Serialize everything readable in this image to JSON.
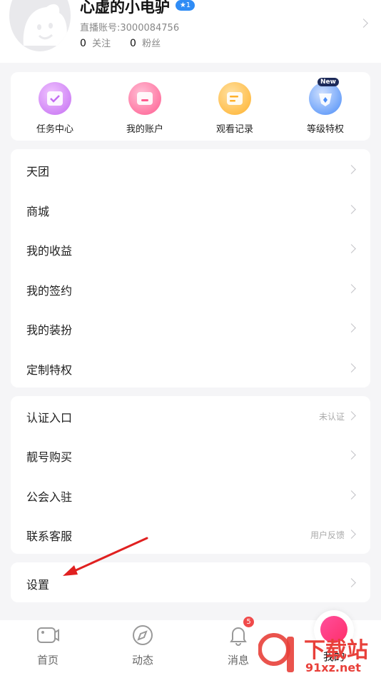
{
  "profile": {
    "username": "心虚的小电驴",
    "level_badge": "★1",
    "account_id": "直播账号:3000084756",
    "following_count": "0",
    "following_label": "关注",
    "fans_count": "0",
    "fans_label": "粉丝"
  },
  "shortcuts": [
    {
      "label": "任务中心",
      "icon": "task-center-icon",
      "color": "#c46df2"
    },
    {
      "label": "我的账户",
      "icon": "wallet-icon",
      "color": "#ff5b8f"
    },
    {
      "label": "观看记录",
      "icon": "history-icon",
      "color": "#ffb12b"
    },
    {
      "label": "等级特权",
      "icon": "privilege-icon",
      "color": "#4a8cf7",
      "tag": "New"
    }
  ],
  "menu_group_1": [
    {
      "label": "天团"
    },
    {
      "label": "商城"
    },
    {
      "label": "我的收益"
    },
    {
      "label": "我的签约"
    },
    {
      "label": "我的装扮"
    },
    {
      "label": "定制特权"
    }
  ],
  "menu_group_2": [
    {
      "label": "认证入口",
      "hint": "未认证"
    },
    {
      "label": "靓号购买",
      "hint": ""
    },
    {
      "label": "公会入驻",
      "hint": ""
    },
    {
      "label": "联系客服",
      "hint": "用户反馈"
    }
  ],
  "settings": {
    "label": "设置"
  },
  "bottom_nav": [
    {
      "label": "首页",
      "icon": "video-camera-icon"
    },
    {
      "label": "动态",
      "icon": "compass-icon"
    },
    {
      "label": "消息",
      "icon": "bell-icon",
      "badge": "5"
    },
    {
      "label": "我的",
      "icon": "me-avatar-icon"
    }
  ],
  "watermark": {
    "text_main": "下载站",
    "text_sub": "91xz.net"
  },
  "colors": {
    "accent_blue": "#2f8cf5",
    "badge_red": "#f04a4a",
    "annotation_arrow": "#e02020"
  }
}
